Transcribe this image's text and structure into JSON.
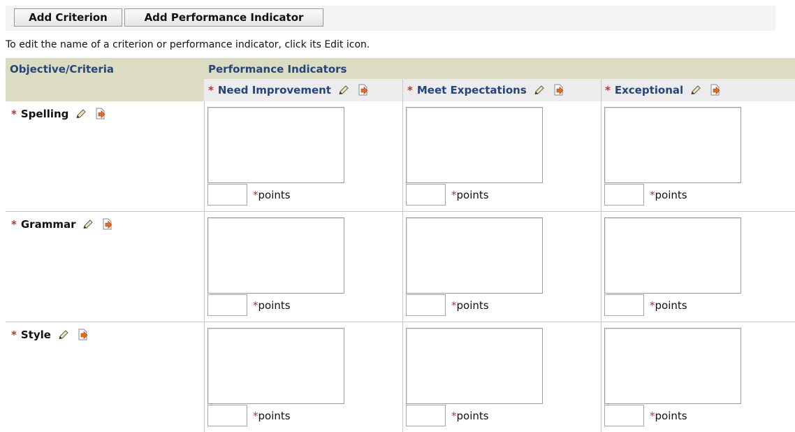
{
  "toolbar": {
    "add_criterion": "Add Criterion",
    "add_performance_indicator": "Add Performance Indicator"
  },
  "hint": "To edit the name of a criterion or performance indicator, click its Edit icon.",
  "headers": {
    "objective": "Objective/Criteria",
    "performance": "Performance Indicators"
  },
  "required_mark": "*",
  "indicators": [
    "Need Improvement",
    "Meet Expectations",
    "Exceptional"
  ],
  "criteria": [
    "Spelling",
    "Grammar",
    "Style"
  ],
  "points_label": "points",
  "colors": {
    "header_bg": "#dcdcc3",
    "subheader_bg": "#ececec",
    "header_text": "#24467c",
    "required": "#d12b1f"
  },
  "icons": {
    "edit": "pencil-icon",
    "move": "move-icon"
  }
}
